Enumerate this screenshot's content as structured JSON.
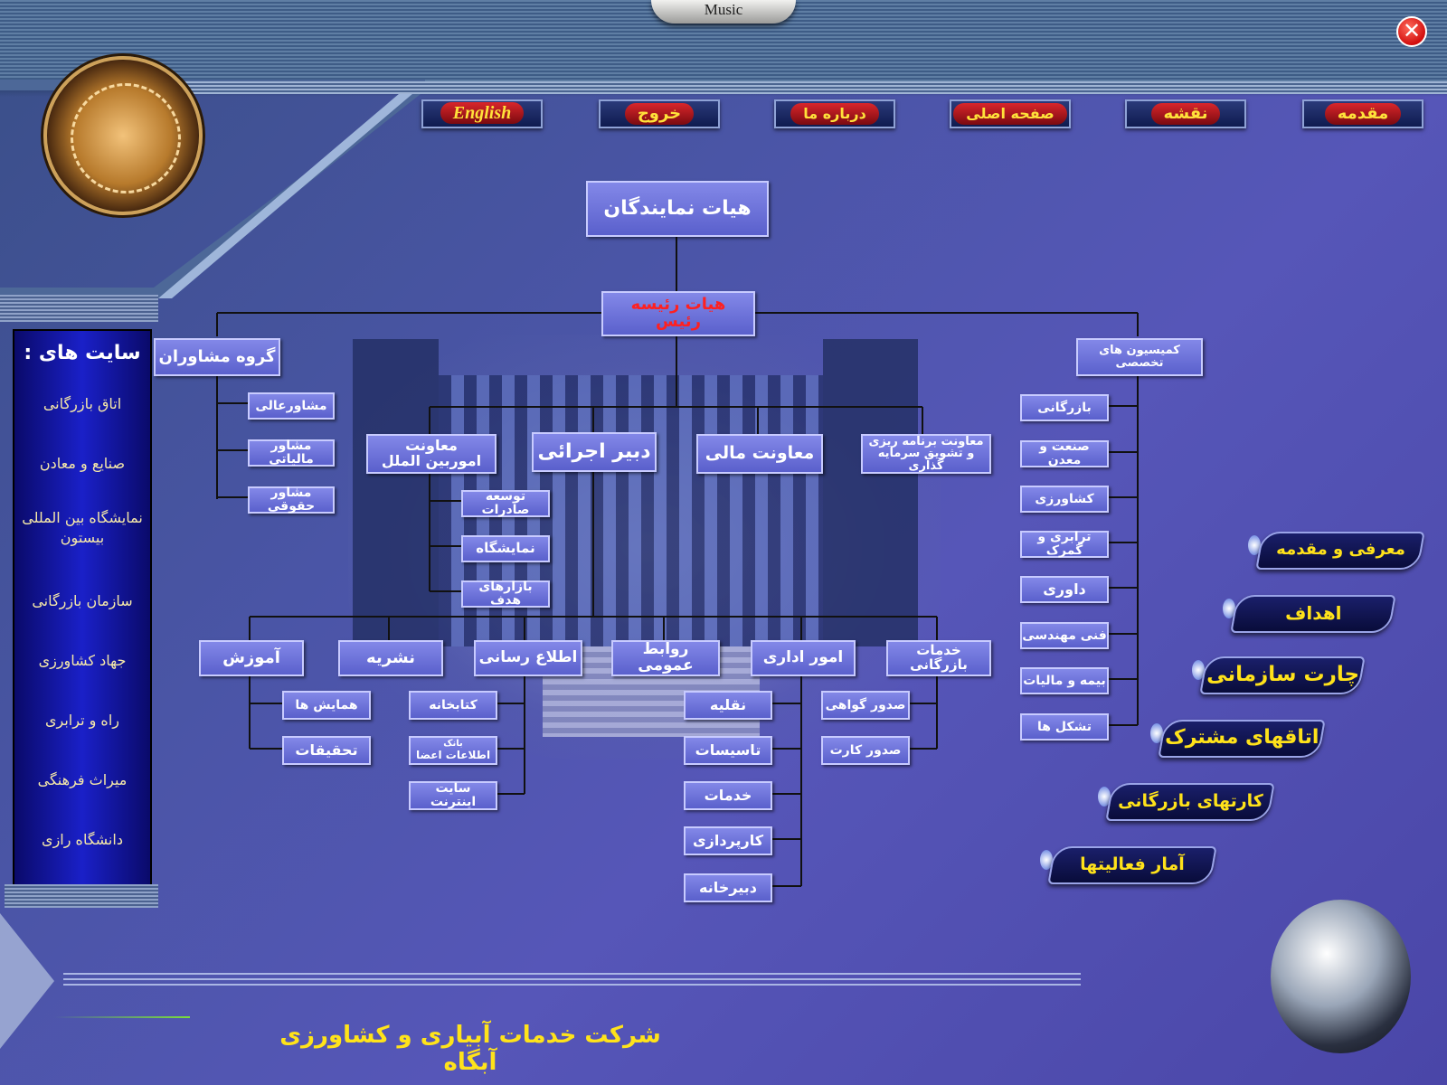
{
  "music_label": "Music",
  "close_label": "✕",
  "nav": {
    "english": "English",
    "exit": "خروج",
    "about": "درباره ما",
    "home": "صفحه اصلی",
    "map": "نقشه",
    "intro": "مقدمه"
  },
  "sidebar": {
    "title": "سایت های :",
    "items": [
      "اتاق بازرگانی",
      "صنایع و معادن",
      "نمایشگاه بین المللی بیستون",
      "سازمان بازرگانی",
      "جهاد کشاورزی",
      "راه و ترابری",
      "میراث فرهنگی",
      "دانشگاه رازی"
    ]
  },
  "chart": {
    "root": "هیات نمایندگان",
    "board_line1": "هیات رئیسه",
    "board_line2": "رئیس",
    "advisors": "گروه مشاوران",
    "advisor_items": [
      "مشاورعالی",
      "مشاور مالیاتی",
      "مشاور حقوقی"
    ],
    "commissions_line1": "کمیسیون های",
    "commissions_line2": "تخصصی",
    "commission_items": [
      "بازرگانی",
      "صنعت و معدن",
      "کشاورزی",
      "ترابری و گمرک",
      "داوری",
      "فنی مهندسی",
      "بیمه و مالیات",
      "تشکل ها"
    ],
    "intl_line1": "معاونت",
    "intl_line2": "اموربین الملل",
    "secretary": "دبیر اجرائی",
    "finance": "معاونت مالی",
    "planning_line1": "معاونت برنامه ریزی",
    "planning_line2": "و تشویق سرمایه گذاری",
    "intl_items": [
      "توسعه صادرات",
      "نمایشگاه",
      "بازارهای هدف"
    ],
    "departments": [
      "آموزش",
      "نشریه",
      "اطلاع رسانی",
      "روابط عمومی",
      "امور اداری",
      "خدمات بازرگانی"
    ],
    "education_items": [
      "همایش ها",
      "تحقیقات"
    ],
    "info_items": [
      "کتابخانه",
      "اطلاعات اعضا",
      "سایت اینترنت"
    ],
    "info_bank_small": "بانک",
    "admin_items": [
      "نقلیه",
      "تاسیسات",
      "خدمات",
      "کارپردازی",
      "دبیرخانه"
    ],
    "services_items": [
      "صدور گواهی",
      "صدور کارت"
    ]
  },
  "right_menu": [
    "معرفی و مقدمه",
    "اهداف",
    "چارت سازمانی",
    "اتاقهای مشترک",
    "کارتهای بازرگانی",
    "آمار فعالیتها"
  ],
  "company": "شرکت خدمات آبیاری و کشاورزی آبگاه"
}
